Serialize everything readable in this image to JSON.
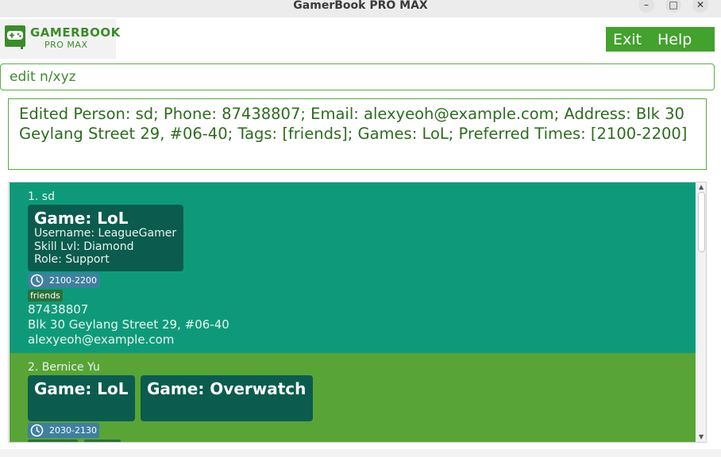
{
  "window": {
    "title": "GamerBook PRO MAX",
    "minimize_glyph": "–",
    "maximize_glyph": "□",
    "close_glyph": "✕"
  },
  "logo": {
    "title": "GAMERBOOK",
    "subtitle": "PRO MAX",
    "icon": "gamepad-book-icon"
  },
  "menu": {
    "exit": "Exit",
    "help": "Help"
  },
  "command": {
    "value": "edit n/xyz"
  },
  "result": {
    "text": "Edited Person: sd; Phone: 87438807; Email: alexyeoh@example.com; Address: Blk 30 Geylang Street 29, #06-40; Tags: [friends]; Games: LoL; Preferred Times: [2100-2200]"
  },
  "persons": [
    {
      "index_name": "1. sd",
      "games": [
        {
          "title": "Game: LoL",
          "username": "Username: LeagueGamer",
          "skill": "Skill Lvl: Diamond",
          "role": "Role: Support"
        }
      ],
      "time": "2100-2200",
      "tags": [
        "friends"
      ],
      "phone": "87438807",
      "address": "Blk 30 Geylang Street 29, #06-40",
      "email": "alexyeoh@example.com"
    },
    {
      "index_name": "2. Bernice Yu",
      "games": [
        {
          "title": "Game: LoL"
        },
        {
          "title": "Game: Overwatch"
        }
      ],
      "time": "2030-2130"
    }
  ],
  "colors": {
    "accent": "#43a12e",
    "card_selected": "#0e9a7a",
    "card_default": "#58a436",
    "game_box": "#0b5c4e",
    "time_badge": "#3f7fa0",
    "tag": "#2b6f39"
  }
}
